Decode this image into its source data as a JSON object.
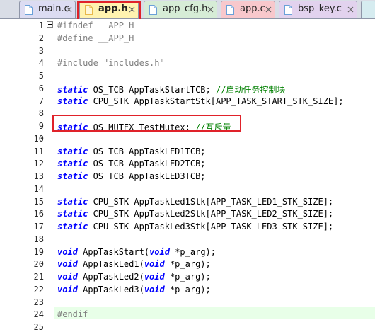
{
  "tabs": [
    {
      "label": "main.c",
      "bg": "#dcdcf2",
      "icon_color": "#6aa0d8"
    },
    {
      "label": "app.h",
      "bg": "#fff3b0",
      "icon_color": "#e8b84a"
    },
    {
      "label": "app_cfg.h",
      "bg": "#d6ecd6",
      "icon_color": "#6aa0d8"
    },
    {
      "label": "app.c",
      "bg": "#f8c8cc",
      "icon_color": "#6aa0d8"
    },
    {
      "label": "bsp_key.c",
      "bg": "#e2d2ee",
      "icon_color": "#6aa0d8"
    }
  ],
  "editor": {
    "lines": [
      {
        "n": "1",
        "segs": [
          [
            "pp",
            "#ifndef __APP_H"
          ]
        ]
      },
      {
        "n": "2",
        "segs": [
          [
            "pp",
            "#define __APP_H"
          ]
        ]
      },
      {
        "n": "3",
        "segs": []
      },
      {
        "n": "4",
        "segs": [
          [
            "pp",
            "#include "
          ],
          [
            "str",
            "\"includes.h\""
          ]
        ]
      },
      {
        "n": "5",
        "segs": []
      },
      {
        "n": "6",
        "segs": [
          [
            "kw",
            "static"
          ],
          [
            "",
            " OS_TCB AppTaskStartTCB; "
          ],
          [
            "cm",
            "//启动任务控制块"
          ]
        ]
      },
      {
        "n": "7",
        "segs": [
          [
            "kw",
            "static"
          ],
          [
            "",
            " CPU_STK AppTaskStartStk[APP_TASK_START_STK_SIZE];"
          ]
        ]
      },
      {
        "n": "8",
        "segs": []
      },
      {
        "n": "9",
        "segs": [
          [
            "kw",
            "static"
          ],
          [
            "",
            " OS_MUTEX TestMutex; "
          ],
          [
            "cm",
            "//互斥量"
          ]
        ]
      },
      {
        "n": "10",
        "segs": []
      },
      {
        "n": "11",
        "segs": [
          [
            "kw",
            "static"
          ],
          [
            "",
            " OS_TCB AppTaskLED1TCB;"
          ]
        ]
      },
      {
        "n": "12",
        "segs": [
          [
            "kw",
            "static"
          ],
          [
            "",
            " OS_TCB AppTaskLED2TCB;"
          ]
        ]
      },
      {
        "n": "13",
        "segs": [
          [
            "kw",
            "static"
          ],
          [
            "",
            " OS_TCB AppTaskLED3TCB;"
          ]
        ]
      },
      {
        "n": "14",
        "segs": []
      },
      {
        "n": "15",
        "segs": [
          [
            "kw",
            "static"
          ],
          [
            "",
            " CPU_STK AppTaskLed1Stk[APP_TASK_LED1_STK_SIZE];"
          ]
        ]
      },
      {
        "n": "16",
        "segs": [
          [
            "kw",
            "static"
          ],
          [
            "",
            " CPU_STK AppTaskLed2Stk[APP_TASK_LED2_STK_SIZE];"
          ]
        ]
      },
      {
        "n": "17",
        "segs": [
          [
            "kw",
            "static"
          ],
          [
            "",
            " CPU_STK AppTaskLed3Stk[APP_TASK_LED3_STK_SIZE];"
          ]
        ]
      },
      {
        "n": "18",
        "segs": []
      },
      {
        "n": "19",
        "segs": [
          [
            "kw",
            "void"
          ],
          [
            "",
            " AppTaskStart("
          ],
          [
            "kw",
            "void"
          ],
          [
            "",
            " *p_arg);"
          ]
        ]
      },
      {
        "n": "20",
        "segs": [
          [
            "kw",
            "void"
          ],
          [
            "",
            " AppTaskLed1("
          ],
          [
            "kw",
            "void"
          ],
          [
            "",
            " *p_arg);"
          ]
        ]
      },
      {
        "n": "21",
        "segs": [
          [
            "kw",
            "void"
          ],
          [
            "",
            " AppTaskLed2("
          ],
          [
            "kw",
            "void"
          ],
          [
            "",
            " *p_arg);"
          ]
        ]
      },
      {
        "n": "22",
        "segs": [
          [
            "kw",
            "void"
          ],
          [
            "",
            " AppTaskLed3("
          ],
          [
            "kw",
            "void"
          ],
          [
            "",
            " *p_arg);"
          ]
        ]
      },
      {
        "n": "23",
        "segs": []
      },
      {
        "n": "24",
        "segs": [
          [
            "pp",
            "#endif"
          ]
        ]
      },
      {
        "n": "25",
        "segs": []
      }
    ]
  }
}
